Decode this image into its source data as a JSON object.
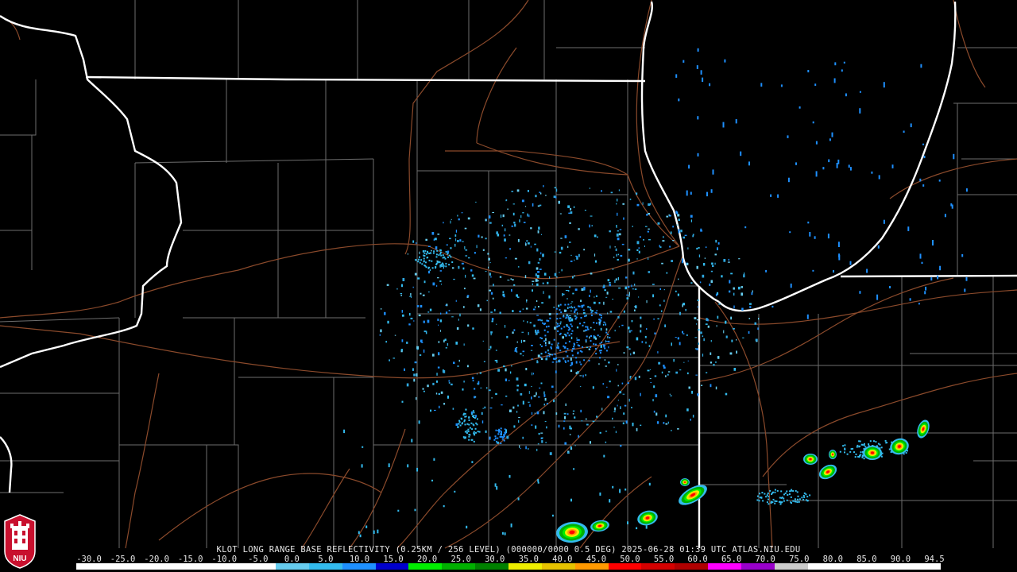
{
  "caption": {
    "product": "KLOT LONG RANGE BASE REFLECTIVITY (0.25KM / 256 LEVEL) (000000/0000 0.5 DEG)",
    "timestamp": "2025-06-28 01:39 UTC",
    "source": "ATLAS.NIU.EDU"
  },
  "logo": {
    "text": "NIU"
  },
  "legend": {
    "labels": [
      "-30.0",
      "-25.0",
      "-20.0",
      "-15.0",
      "-10.0",
      "-5.0",
      "0.0",
      "5.0",
      "10.0",
      "15.0",
      "20.0",
      "25.0",
      "30.0",
      "35.0",
      "40.0",
      "45.0",
      "50.0",
      "55.0",
      "60.0",
      "65.0",
      "70.0",
      "75.0",
      "80.0",
      "85.0",
      "90.0",
      "94.5"
    ],
    "colors": [
      "#ffffff",
      "#ffffff",
      "#ffffff",
      "#ffffff",
      "#ffffff",
      "#ffffff",
      "#66ccee",
      "#33bbee",
      "#1e90ff",
      "#0000cc",
      "#00ee00",
      "#00b000",
      "#008000",
      "#eeee00",
      "#e6c200",
      "#ff9900",
      "#ff0000",
      "#d40000",
      "#b00000",
      "#ff00ff",
      "#9900cc",
      "#cccccc",
      "#ffffff",
      "#ffffff",
      "#ffffff",
      "#ffffff"
    ]
  },
  "colors": {
    "background": "#000000",
    "state_border": "#ffffff",
    "county_line": "#7a7a7a",
    "highway": "#8b4a2b"
  }
}
